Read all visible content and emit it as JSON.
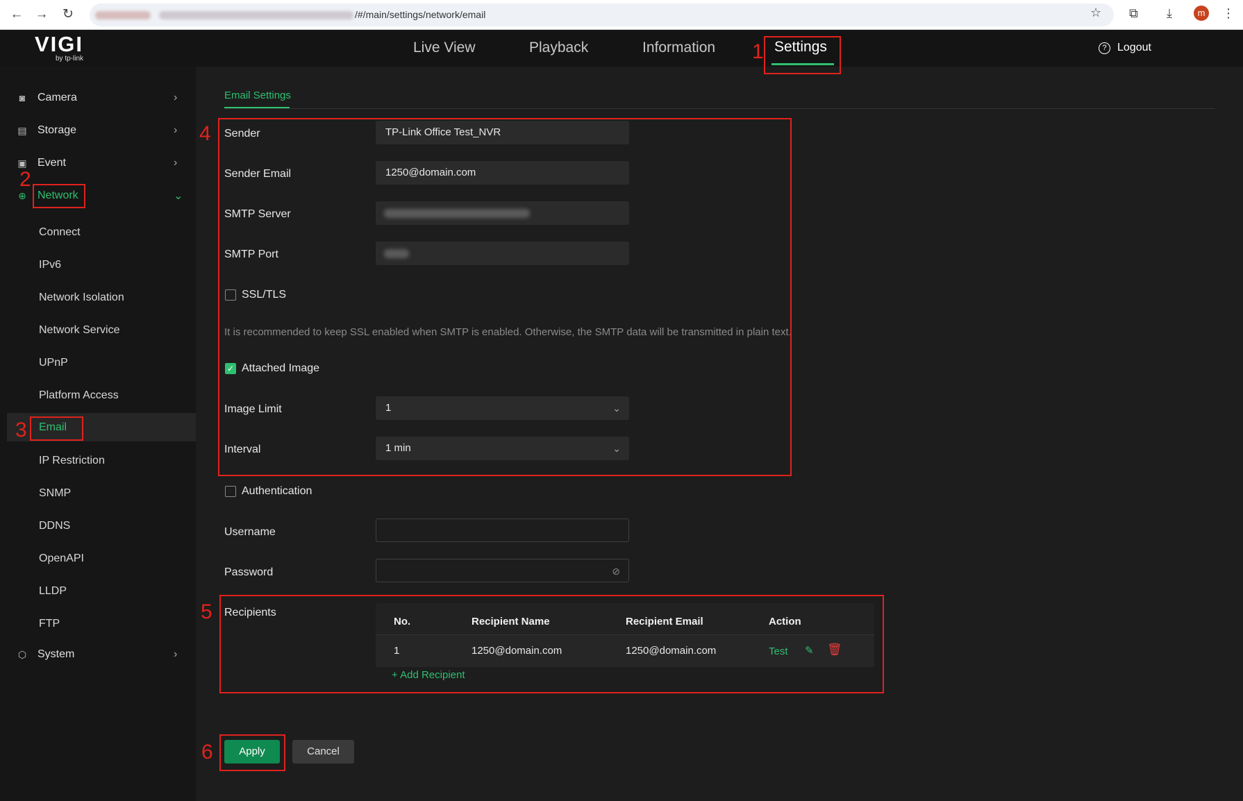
{
  "browser": {
    "url": "/#/main/settings/network/email",
    "profile_initial": "m"
  },
  "header": {
    "logo": "VIGI",
    "logo_sub": "by tp-link",
    "tabs": [
      "Live View",
      "Playback",
      "Information",
      "Settings"
    ],
    "active_tab": "Settings",
    "logout": "Logout"
  },
  "sidebar": {
    "items": [
      {
        "label": "Camera",
        "icon": "camera-icon"
      },
      {
        "label": "Storage",
        "icon": "storage-icon"
      },
      {
        "label": "Event",
        "icon": "event-icon"
      },
      {
        "label": "Network",
        "icon": "globe-icon"
      }
    ],
    "network_sub": [
      "Connect",
      "IPv6",
      "Network Isolation",
      "Network Service",
      "UPnP",
      "Platform Access",
      "Email",
      "IP Restriction",
      "SNMP",
      "DDNS",
      "OpenAPI",
      "LLDP",
      "FTP"
    ],
    "system": {
      "label": "System",
      "icon": "system-icon"
    },
    "selected_sub": "Email"
  },
  "email_settings": {
    "tab": "Email Settings",
    "sender_label": "Sender",
    "sender_value": "TP-Link Office Test_NVR",
    "sender_email_label": "Sender Email",
    "sender_email_value": "1250@domain.com",
    "smtp_server_label": "SMTP Server",
    "smtp_port_label": "SMTP Port",
    "ssl_label": "SSL/TLS",
    "ssl_checked": false,
    "hint": "It is recommended to keep SSL enabled when SMTP is enabled. Otherwise, the SMTP data will be transmitted in plain text.",
    "attached_image_label": "Attached Image",
    "attached_image_checked": true,
    "image_limit_label": "Image Limit",
    "image_limit_value": "1",
    "interval_label": "Interval",
    "interval_value": "1 min",
    "authentication_label": "Authentication",
    "authentication_checked": false,
    "username_label": "Username",
    "password_label": "Password",
    "recipients_label": "Recipients"
  },
  "recipients": {
    "columns": [
      "No.",
      "Recipient Name",
      "Recipient Email",
      "Action"
    ],
    "rows": [
      {
        "no": "1",
        "name": "1250@domain.com",
        "email": "1250@domain.com",
        "action_test": "Test"
      }
    ],
    "add": "Add Recipient"
  },
  "buttons": {
    "apply": "Apply",
    "cancel": "Cancel"
  },
  "annotations": {
    "n1": "1",
    "n2": "2",
    "n3": "3",
    "n4": "4",
    "n5": "5",
    "n6": "6",
    "color": "#e1221d"
  },
  "colors": {
    "accent": "#2fbf71",
    "apply_bg": "#0f8a50",
    "delete": "#e23b3b"
  }
}
